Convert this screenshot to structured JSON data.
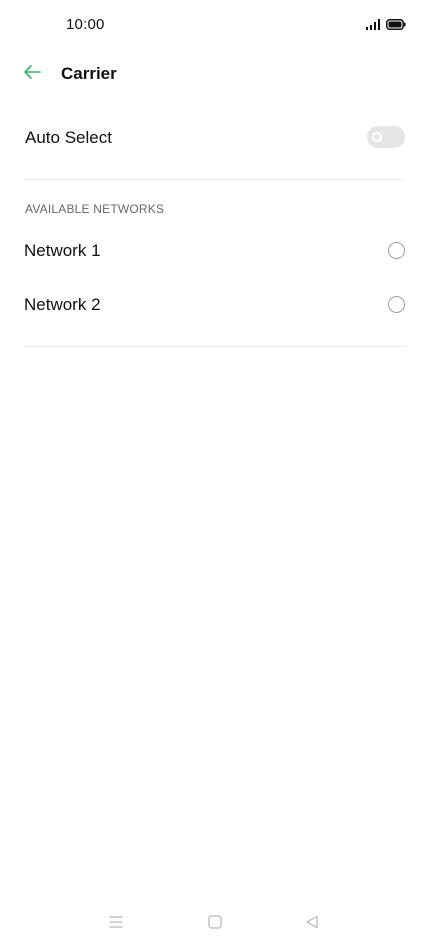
{
  "status_bar": {
    "time": "10:00"
  },
  "header": {
    "back_icon": "arrow-left-icon",
    "title": "Carrier",
    "accent_color": "#2fb86c"
  },
  "auto_select": {
    "label": "Auto Select",
    "enabled": false
  },
  "available_networks": {
    "section_title": "AVAILABLE NETWORKS",
    "items": [
      {
        "label": "Network 1",
        "selected": false
      },
      {
        "label": "Network 2",
        "selected": false
      }
    ]
  },
  "nav_bar": {
    "icons": [
      "menu-icon",
      "home-square-icon",
      "back-triangle-icon"
    ]
  }
}
